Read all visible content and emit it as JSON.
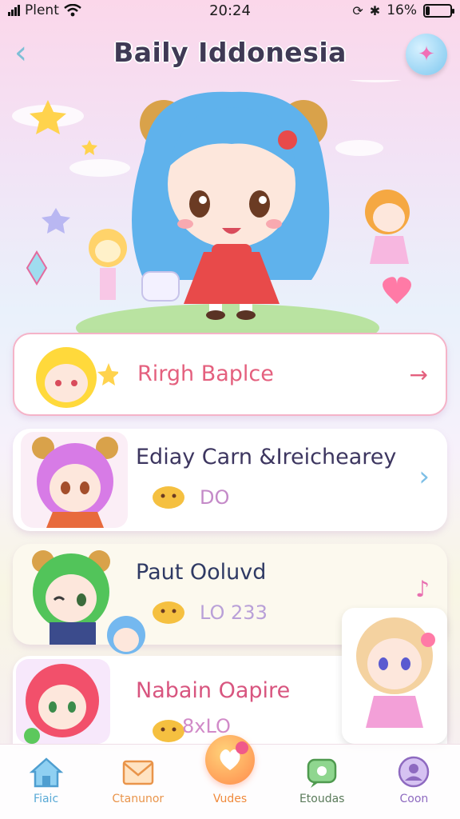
{
  "status_bar": {
    "carrier": "Plent",
    "time": "20:24",
    "battery": "16%",
    "battery_level": 0.16
  },
  "header": {
    "title": "Baily Iddonesia",
    "back_icon": "chevron-left-icon",
    "share_icon": "share-icon"
  },
  "cards": [
    {
      "title": "Rirgh Baplce",
      "subtitle": "",
      "arrow": "→",
      "title_color": "#e4607e"
    },
    {
      "title": "Ediay Carn &Ireichearey",
      "subtitle": "DO",
      "arrow": "›",
      "title_color": "#3d3660"
    },
    {
      "title": "Paut Ooluvd",
      "subtitle": "LO   233",
      "arrow": "♪",
      "title_color": "#2f3a64"
    },
    {
      "title": "Nabain Oapire",
      "subtitle": "8xLO",
      "arrow": "",
      "title_color": "#d8557f"
    }
  ],
  "tabs": [
    {
      "label": "Fiaic",
      "icon": "home-icon",
      "color": "#58a9d6"
    },
    {
      "label": "Ctanunor",
      "icon": "mail-icon",
      "color": "#e9944a"
    },
    {
      "label": "Vudes",
      "icon": "heart-chat-icon",
      "color": "#f08a3c"
    },
    {
      "label": "Etoudas",
      "icon": "chat-bubble-icon",
      "color": "#5aa35a"
    },
    {
      "label": "Coon",
      "icon": "profile-icon",
      "color": "#8e6ac0"
    }
  ]
}
